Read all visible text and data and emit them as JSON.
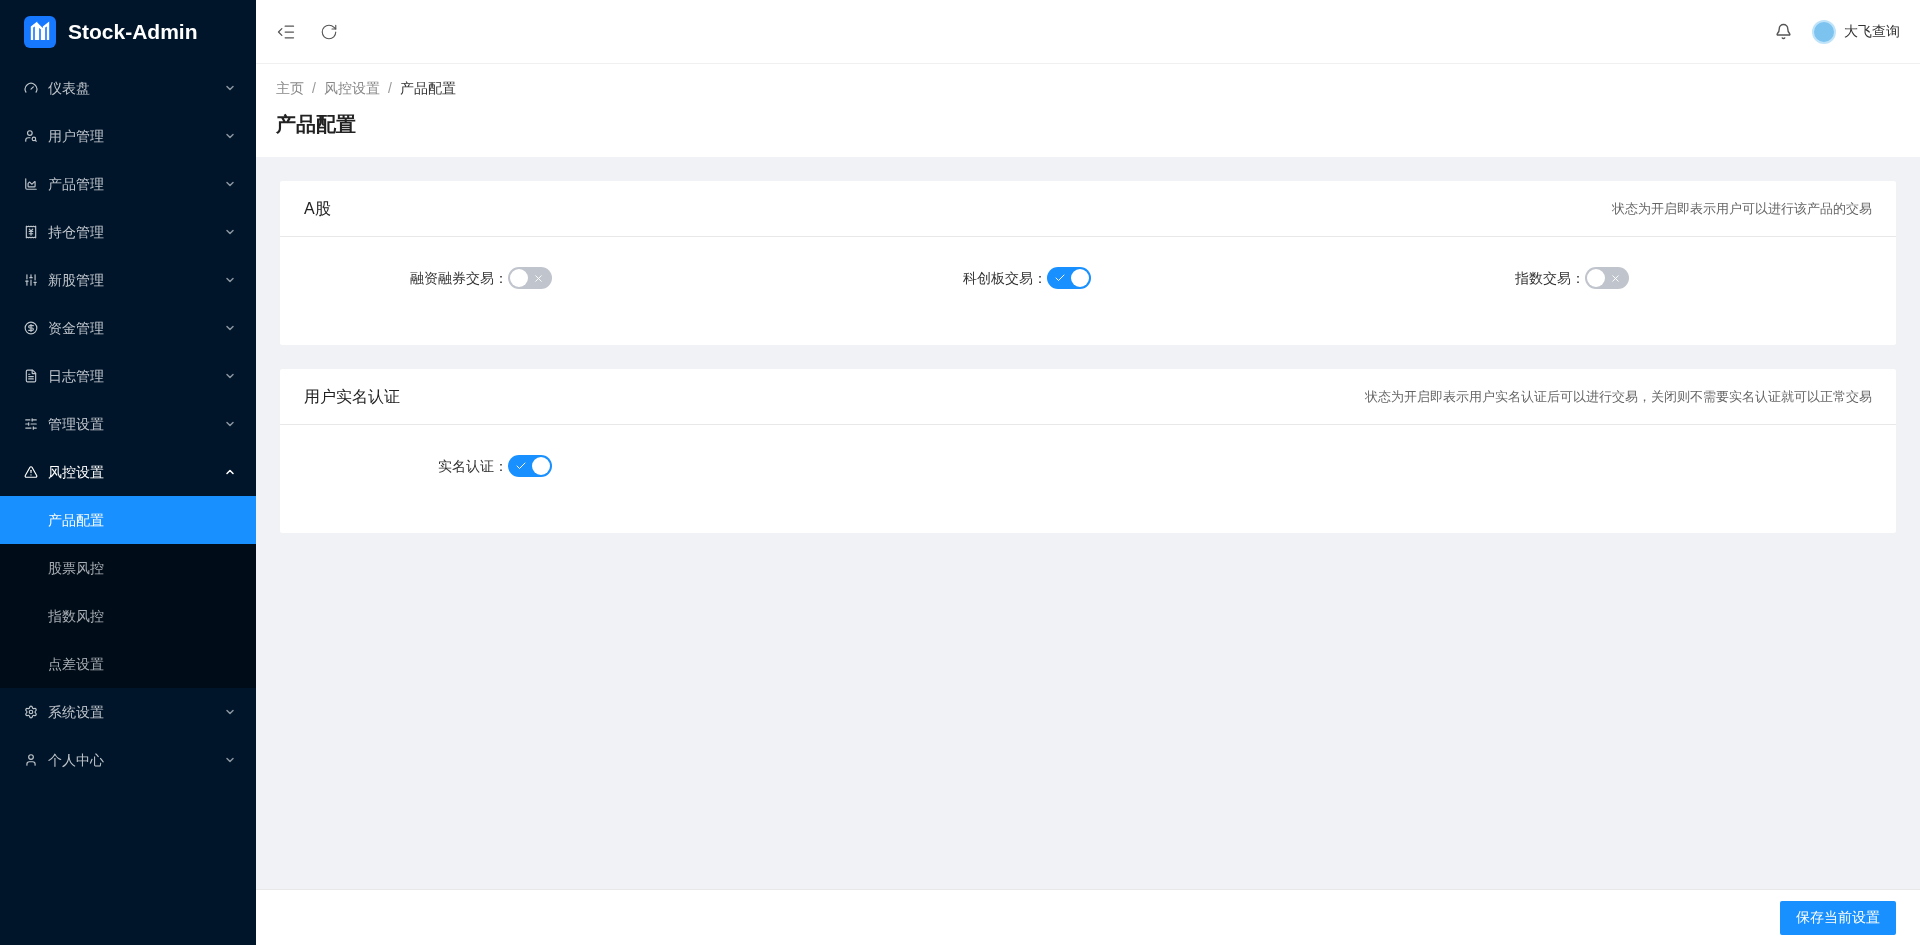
{
  "brand": {
    "name": "Stock-Admin"
  },
  "sidebar": {
    "items": [
      {
        "label": "仪表盘",
        "expanded": false
      },
      {
        "label": "用户管理",
        "expanded": false
      },
      {
        "label": "产品管理",
        "expanded": false
      },
      {
        "label": "持仓管理",
        "expanded": false
      },
      {
        "label": "新股管理",
        "expanded": false
      },
      {
        "label": "资金管理",
        "expanded": false
      },
      {
        "label": "日志管理",
        "expanded": false
      },
      {
        "label": "管理设置",
        "expanded": false
      },
      {
        "label": "风控设置",
        "expanded": true,
        "children": [
          {
            "label": "产品配置",
            "selected": true
          },
          {
            "label": "股票风控",
            "selected": false
          },
          {
            "label": "指数风控",
            "selected": false
          },
          {
            "label": "点差设置",
            "selected": false
          }
        ]
      },
      {
        "label": "系统设置",
        "expanded": false
      },
      {
        "label": "个人中心",
        "expanded": false
      }
    ]
  },
  "header": {
    "user": "大飞查询"
  },
  "breadcrumb": [
    "主页",
    "风控设置",
    "产品配置"
  ],
  "breadcrumb_separator": "/",
  "page_title": "产品配置",
  "cards": [
    {
      "title": "A股",
      "note": "状态为开启即表示用户可以进行该产品的交易",
      "switches": [
        {
          "label": "融资融券交易：",
          "on": false
        },
        {
          "label": "科创板交易：",
          "on": true
        },
        {
          "label": "指数交易：",
          "on": false
        }
      ]
    },
    {
      "title": "用户实名认证",
      "note": "状态为开启即表示用户实名认证后可以进行交易，关闭则不需要实名认证就可以正常交易",
      "switches": [
        {
          "label": "实名认证：",
          "on": true
        }
      ]
    }
  ],
  "footer": {
    "button": "保存当前设置"
  }
}
